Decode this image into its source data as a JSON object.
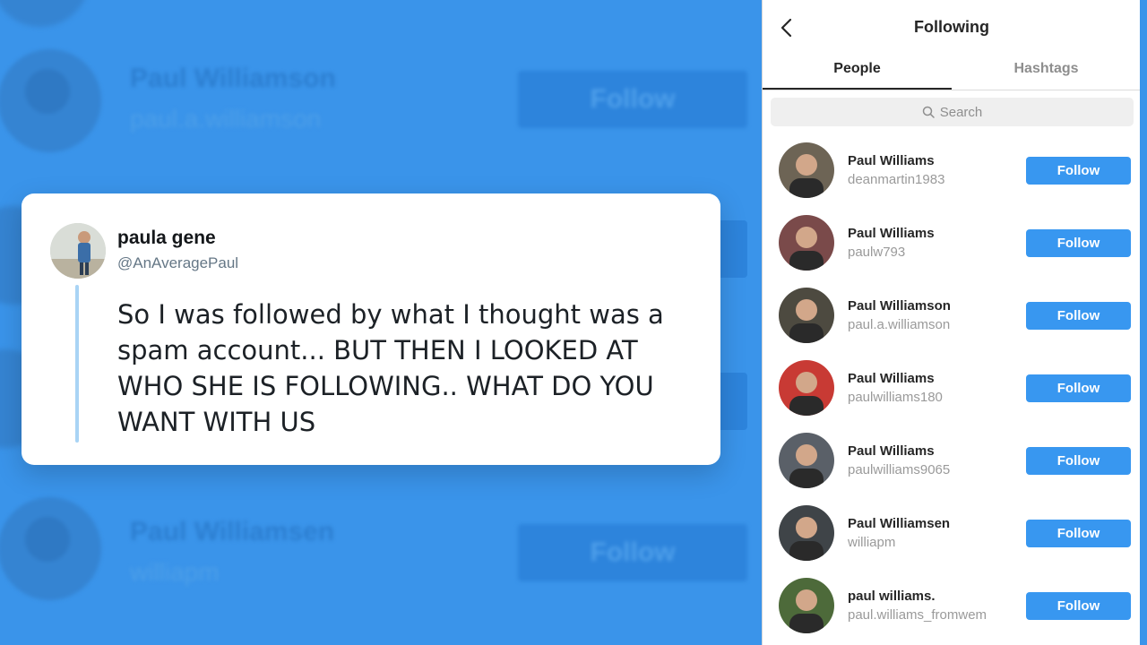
{
  "background": {
    "rows": [
      {
        "name": "Paul Williamson",
        "handle": "paul.a.williamson",
        "button": "Follow"
      },
      {
        "name": "Paul Williamsen",
        "handle": "williapm",
        "button": "Follow"
      }
    ]
  },
  "tweet": {
    "display_name": "paula gene",
    "handle": "@AnAveragePaul",
    "text": "So I was followed by what I thought was a spam account... BUT THEN I LOOKED AT WHO SHE IS FOLLOWING.. WHAT DO YOU WANT WITH US"
  },
  "panel": {
    "title": "Following",
    "tabs": [
      {
        "label": "People",
        "active": true
      },
      {
        "label": "Hashtags",
        "active": false
      }
    ],
    "search": {
      "placeholder": "Search",
      "icon": "search-icon"
    },
    "follow_label": "Follow",
    "users": [
      {
        "name": "Paul Williams",
        "handle": "deanmartin1983",
        "avatar_color": "#6d6455"
      },
      {
        "name": "Paul Williams",
        "handle": "paulw793",
        "avatar_color": "#7a4a4a"
      },
      {
        "name": "Paul Williamson",
        "handle": "paul.a.williamson",
        "avatar_color": "#4d4a40"
      },
      {
        "name": "Paul Williams",
        "handle": "paulwilliams180",
        "avatar_color": "#c83a34"
      },
      {
        "name": "Paul Williams",
        "handle": "paulwilliams9065",
        "avatar_color": "#5a6068"
      },
      {
        "name": "Paul Williamsen",
        "handle": "williapm",
        "avatar_color": "#3f4448"
      },
      {
        "name": "paul  williams.",
        "handle": "paul.williams_fromwem",
        "avatar_color": "#4d6a3a"
      }
    ]
  },
  "colors": {
    "background_blue": "#3a94ea",
    "follow_button": "#3897f0",
    "tweet_rule": "#a9d4f5"
  }
}
